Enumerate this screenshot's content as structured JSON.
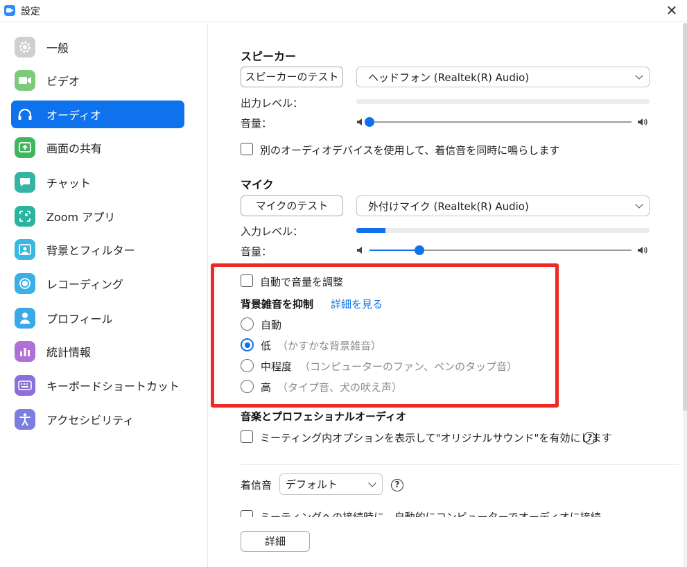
{
  "window": {
    "title": "設定"
  },
  "sidebar": {
    "items": [
      {
        "label": "一般",
        "icon": "gear-icon",
        "color": "#c8c8c8"
      },
      {
        "label": "ビデオ",
        "icon": "video-icon",
        "color": "#7ccb7a"
      },
      {
        "label": "オーディオ",
        "icon": "headphones-icon",
        "color": "#0e72ed",
        "active": true
      },
      {
        "label": "画面の共有",
        "icon": "share-screen-icon",
        "color": "#43b55f"
      },
      {
        "label": "チャット",
        "icon": "chat-icon",
        "color": "#33b4a4"
      },
      {
        "label": "Zoom アプリ",
        "icon": "apps-icon",
        "color": "#2bb5a0"
      },
      {
        "label": "背景とフィルター",
        "icon": "background-icon",
        "color": "#3ab8e0"
      },
      {
        "label": "レコーディング",
        "icon": "recording-icon",
        "color": "#3ab0e8"
      },
      {
        "label": "プロフィール",
        "icon": "profile-icon",
        "color": "#3aa9e8"
      },
      {
        "label": "統計情報",
        "icon": "statistics-icon",
        "color": "#b070d8"
      },
      {
        "label": "キーボードショートカット",
        "icon": "keyboard-icon",
        "color": "#8a70d8"
      },
      {
        "label": "アクセシビリティ",
        "icon": "accessibility-icon",
        "color": "#7a7ee0"
      }
    ]
  },
  "speaker": {
    "title": "スピーカー",
    "test_button": "スピーカーのテスト",
    "device": "ヘッドフォン (Realtek(R) Audio)",
    "output_level_label": "出力レベル：",
    "output_level": 0.0,
    "volume_label": "音量：",
    "volume": 0.0
  },
  "separate_device": {
    "label": "別のオーディオデバイスを使用して、着信音を同時に鳴らします",
    "checked": false
  },
  "mic": {
    "title": "マイク",
    "test_button": "マイクのテスト",
    "device": "外付けマイク (Realtek(R) Audio)",
    "input_level_label": "入力レベル：",
    "input_level": 0.1,
    "volume_label": "音量：",
    "volume": 0.19
  },
  "auto_adjust": {
    "label": "自動で音量を調整",
    "checked": false
  },
  "noise": {
    "title": "背景雑音を抑制",
    "link": "詳細を見る",
    "options": [
      {
        "label": "自動",
        "note": "",
        "checked": false
      },
      {
        "label": "低",
        "note": "（かすかな背景雑音）",
        "checked": true
      },
      {
        "label": "中程度",
        "note": "（コンピューターのファン、ペンのタップ音）",
        "checked": false
      },
      {
        "label": "高",
        "note": "（タイプ音、犬の吠え声）",
        "checked": false
      }
    ]
  },
  "music": {
    "title": "音楽とプロフェショナルオーディオ",
    "option_label": "ミーティング内オプションを表示して\"オリジナルサウンド\"を有効にします",
    "checked": false
  },
  "ringtone": {
    "label": "着信音",
    "value": "デフォルト"
  },
  "auto_join": {
    "label": "ミーティングへの接続時に、自動的にコンピューターでオーディオに接続"
  },
  "advanced_button": "詳細",
  "colors": {
    "accent": "#0e72ed",
    "highlight": "#ee2a24"
  }
}
